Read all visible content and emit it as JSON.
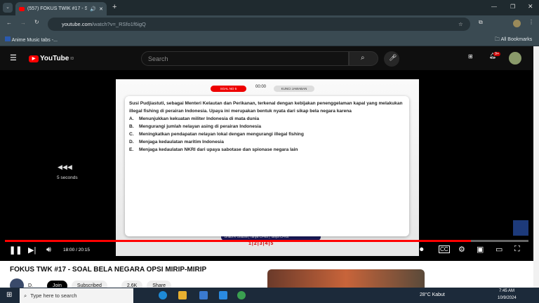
{
  "browser": {
    "tab_title": "(557) FOKUS TWIK #17 - SO",
    "url_host": "youtube.com",
    "url_path": "/watch?v=_RSfo1f6igQ",
    "bookmark": "Anime Music tabs -...",
    "all_bookmarks": "All Bookmarks"
  },
  "youtube": {
    "logo": "YouTube",
    "region": "ID",
    "search_placeholder": "Search",
    "notif_count": "9+"
  },
  "video": {
    "soal_label": "SOAL NO 5",
    "timer": "00:00",
    "kunci_label": "KUNCI JAWABAN",
    "question": "Susi Pudjiastuti, sebagai Menteri Kelautan dan Perikanan, terkenal dengan kebijakan penenggelaman kapal yang melakukan illegal fishing di perairan Indonesia. Upaya ini merupakan bentuk nyata dari sikap bela negara karena",
    "options": [
      {
        "letter": "A.",
        "text": "Menunjukkan kekuatan militer Indonesia di mata dunia"
      },
      {
        "letter": "B.",
        "text": "Mengurangi jumlah nelayan asing di perairan Indonesia"
      },
      {
        "letter": "C.",
        "text": "Meningkatkan pendapatan nelayan lokal dengan mengurangi illegal fishing"
      },
      {
        "letter": "D.",
        "text": "Menjaga kedaulatan maritim Indonesia"
      },
      {
        "letter": "E.",
        "text": "Menjaga kedaulatan NKRI dari upaya sabotase dan spionase negara lain"
      }
    ],
    "social": "Dhadi R Ghazali  |  Tanya CPNS  |  Tanya CPNS",
    "pages": "1|2|3|4|5",
    "rewind_label": "5 seconds",
    "time": "18:00 / 20:15",
    "progress": 0.89
  },
  "page": {
    "title": "FOKUS TWK #17 - SOAL BELA NEGARA OPSI MIRIP-MIRIP",
    "channel": "D.",
    "join": "Join",
    "subscribed": "Subscribed",
    "likes": "2.6K",
    "share": "Share"
  },
  "taskbar": {
    "search": "Type here to search",
    "weather": "28°C  Kabut",
    "time": "7:45 AM",
    "date": "10/9/2024"
  }
}
